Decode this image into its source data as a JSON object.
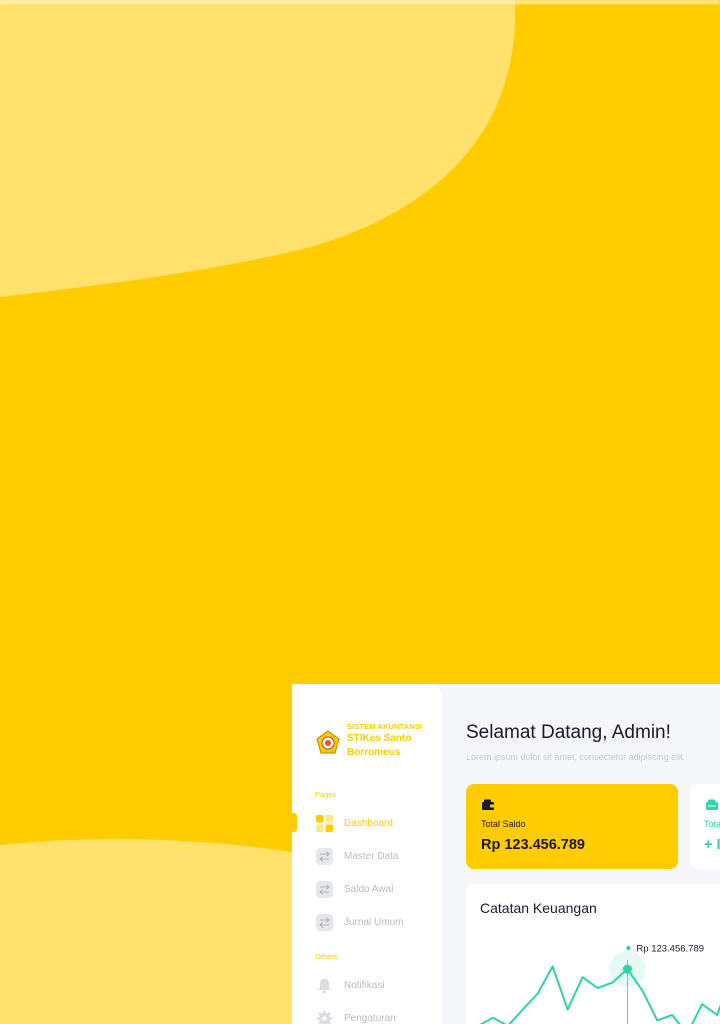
{
  "sidebar": {
    "brand_small": "SISTEM AKUNTANSI",
    "brand_name": "STIKes Santo Borromeus",
    "section_pages": "Pages",
    "section_others": "Others",
    "items": [
      {
        "label": "Dashboard",
        "icon": "dashboard-icon",
        "active": true
      },
      {
        "label": "Master Data",
        "icon": "transfer-icon",
        "active": false
      },
      {
        "label": "Saldo Awal",
        "icon": "transfer-icon",
        "active": false
      },
      {
        "label": "Jurnal Umum",
        "icon": "transfer-icon",
        "active": false
      },
      {
        "label": "Notifikasi",
        "icon": "bell-icon",
        "active": false
      },
      {
        "label": "Pengaturan",
        "icon": "gear-icon",
        "active": false
      }
    ]
  },
  "main": {
    "greeting": "Selamat Datang, Admin!",
    "subtitle": "Lorem ipsum dolor sit amet, consectetur adipiscing elit.",
    "card_saldo": {
      "label": "Total Saldo",
      "value": "Rp 123.456.789",
      "icon": "wallet-icon"
    },
    "card_second": {
      "label": "Tota",
      "value": "+ I",
      "icon": "cash-icon"
    },
    "chart_title": "Catatan Keuangan",
    "chart_tooltip": "Rp 123.456.789"
  },
  "colors": {
    "brand": "#FFCC00",
    "brand_light": "#FFE16B",
    "accent": "#2DD4A7",
    "muted": "#B7BBC2"
  },
  "chart_data": {
    "type": "line",
    "title": "Catatan Keuangan",
    "series": [
      {
        "values": [
          6,
          9,
          6,
          12,
          18,
          28,
          12,
          24,
          20,
          22,
          27,
          19,
          8,
          10,
          3,
          14,
          10,
          25
        ]
      }
    ],
    "ylim": [
      0,
      40
    ],
    "highlight_index": 10,
    "highlight_label": "Rp 123.456.789"
  }
}
